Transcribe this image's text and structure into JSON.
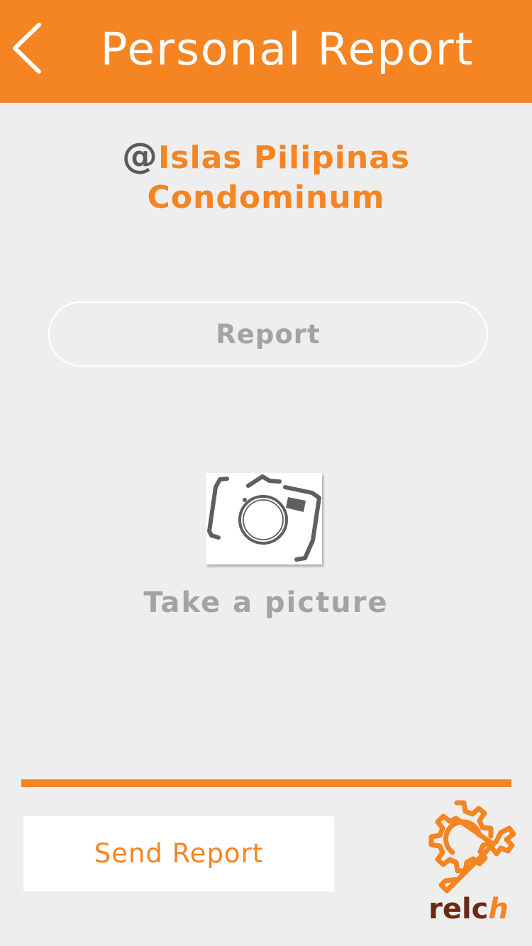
{
  "header": {
    "title": "Personal Report",
    "back_icon": "chevron-left-icon"
  },
  "location": {
    "prefix": "@",
    "name_line1": "Islas Pilipinas",
    "name_line2": "Condominum"
  },
  "report": {
    "placeholder": "Report",
    "value": ""
  },
  "photo": {
    "icon": "camera-icon",
    "label": "Take a picture"
  },
  "footer": {
    "send_label": "Send Report",
    "logo_word_main": "relc",
    "logo_word_accent": "h"
  },
  "colors": {
    "accent": "#f58422",
    "background": "#eeeeee",
    "muted_text": "#a3a3a3",
    "dark_text": "#5b5b5b",
    "logo_brown": "#6b2a14"
  }
}
